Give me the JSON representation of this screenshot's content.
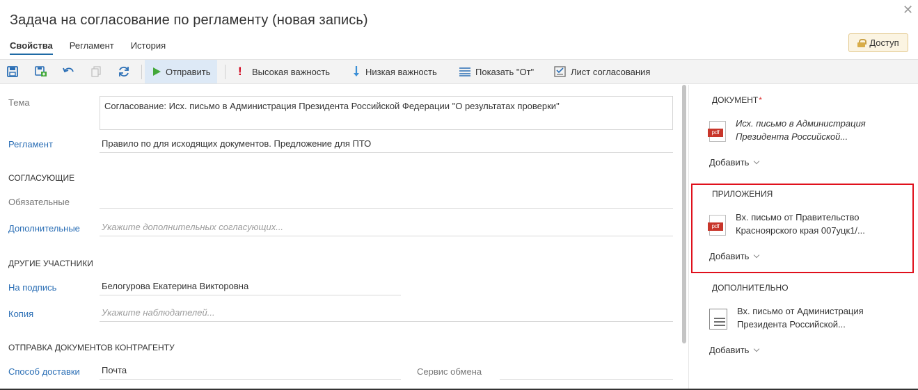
{
  "window": {
    "title": "Задача на согласование по регламенту (новая запись)"
  },
  "tabs": [
    {
      "label": "Свойства",
      "active": true
    },
    {
      "label": "Регламент",
      "active": false
    },
    {
      "label": "История",
      "active": false
    }
  ],
  "access_button": {
    "label": "Доступ"
  },
  "toolbar": {
    "send_label": "Отправить",
    "high_importance_label": "Высокая важность",
    "low_importance_label": "Низкая важность",
    "show_from_label": "Показать \"От\"",
    "approval_sheet_label": "Лист согласования"
  },
  "form": {
    "topic": {
      "label": "Тема",
      "value": "Согласование: Исх. письмо в Администрация Президента Российской Федерации \"О результатах проверки\""
    },
    "regulation": {
      "label": "Регламент",
      "value": "Правило по  для исходящих документов. Предложение для ПТО"
    },
    "approvers_section": "СОГЛАСУЮЩИЕ",
    "mandatory": {
      "label": "Обязательные",
      "value": ""
    },
    "additional": {
      "label": "Дополнительные",
      "placeholder": "Укажите дополнительных согласующих..."
    },
    "others_section": "ДРУГИЕ УЧАСТНИКИ",
    "signer": {
      "label": "На подпись",
      "value": "Белогурова Екатерина Викторовна"
    },
    "copy": {
      "label": "Копия",
      "placeholder": "Укажите наблюдателей..."
    },
    "delivery_section": "ОТПРАВКА ДОКУМЕНТОВ КОНТРАГЕНТУ",
    "delivery_method": {
      "label": "Способ доставки",
      "value": "Почта"
    },
    "exchange_service": {
      "label": "Сервис обмена",
      "value": ""
    }
  },
  "side": {
    "document": {
      "heading": "ДОКУМЕНТ",
      "required_mark": "*",
      "file_line1": "Исх. письмо в Администрация",
      "file_line2": "Президента Российской...",
      "icon": "pdf-icon",
      "add_label": "Добавить"
    },
    "attachments": {
      "heading": "ПРИЛОЖЕНИЯ",
      "file_line1": "Вх. письмо от Правительство",
      "file_line2": "Красноярского края 007уцк1/...",
      "icon": "pdf-icon",
      "add_label": "Добавить"
    },
    "additional": {
      "heading": "ДОПОЛНИТЕЛЬНО",
      "file_line1": "Вх. письмо от Администрация",
      "file_line2": "Президента Российской...",
      "icon": "document-icon",
      "add_label": "Добавить"
    }
  },
  "colors": {
    "accent": "#2a6eb5",
    "highlight_frame": "#e0101c",
    "send_green": "#43a83a",
    "importance_red": "#d0021b",
    "low_blue": "#3b8fd6"
  },
  "icon_pdf_badge": "pdf"
}
